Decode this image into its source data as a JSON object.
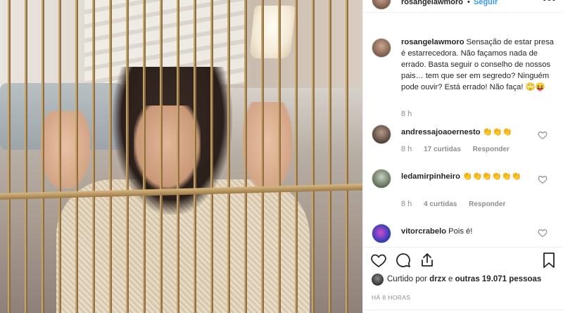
{
  "post": {
    "username": "rosangelawmoro",
    "separator": "•",
    "follow_label": "Seguir",
    "more_label": "•••"
  },
  "caption": {
    "username": "rosangelawmoro",
    "text": "Sensação de estar presa é estarrecedora. Não façamos nada de errado. Basta seguir o conselho de nossos pais… tem que ser em segredo? Ninguém pode ouvir? Está errado! Não faça! 🙄😝",
    "time": "8 h"
  },
  "comments": [
    {
      "username": "andressajoaoernesto",
      "text": "👏👏👏",
      "time": "8 h",
      "likes": "17 curtidas",
      "reply": "Responder",
      "avatar_color": "#6b5a50"
    },
    {
      "username": "ledamirpinheiro",
      "text": "👏👏👏👏👏👏",
      "time": "8 h",
      "likes": "4 curtidas",
      "reply": "Responder",
      "avatar_color": "#7d8a78"
    },
    {
      "username": "vitorcrabelo",
      "text": "Pois é!",
      "avatar_color": "#3a3fb8"
    }
  ],
  "likes": {
    "prefix": "Curtido por",
    "user": "drzx",
    "conj": "e",
    "others": "outras 19.071 pessoas"
  },
  "timestamp": "HÁ 8 HORAS",
  "icons": [
    "heart-icon",
    "comment-icon",
    "share-icon",
    "bookmark-icon"
  ],
  "colors": {
    "link": "#3897f0",
    "muted": "#8e8e8e",
    "text": "#262626"
  }
}
